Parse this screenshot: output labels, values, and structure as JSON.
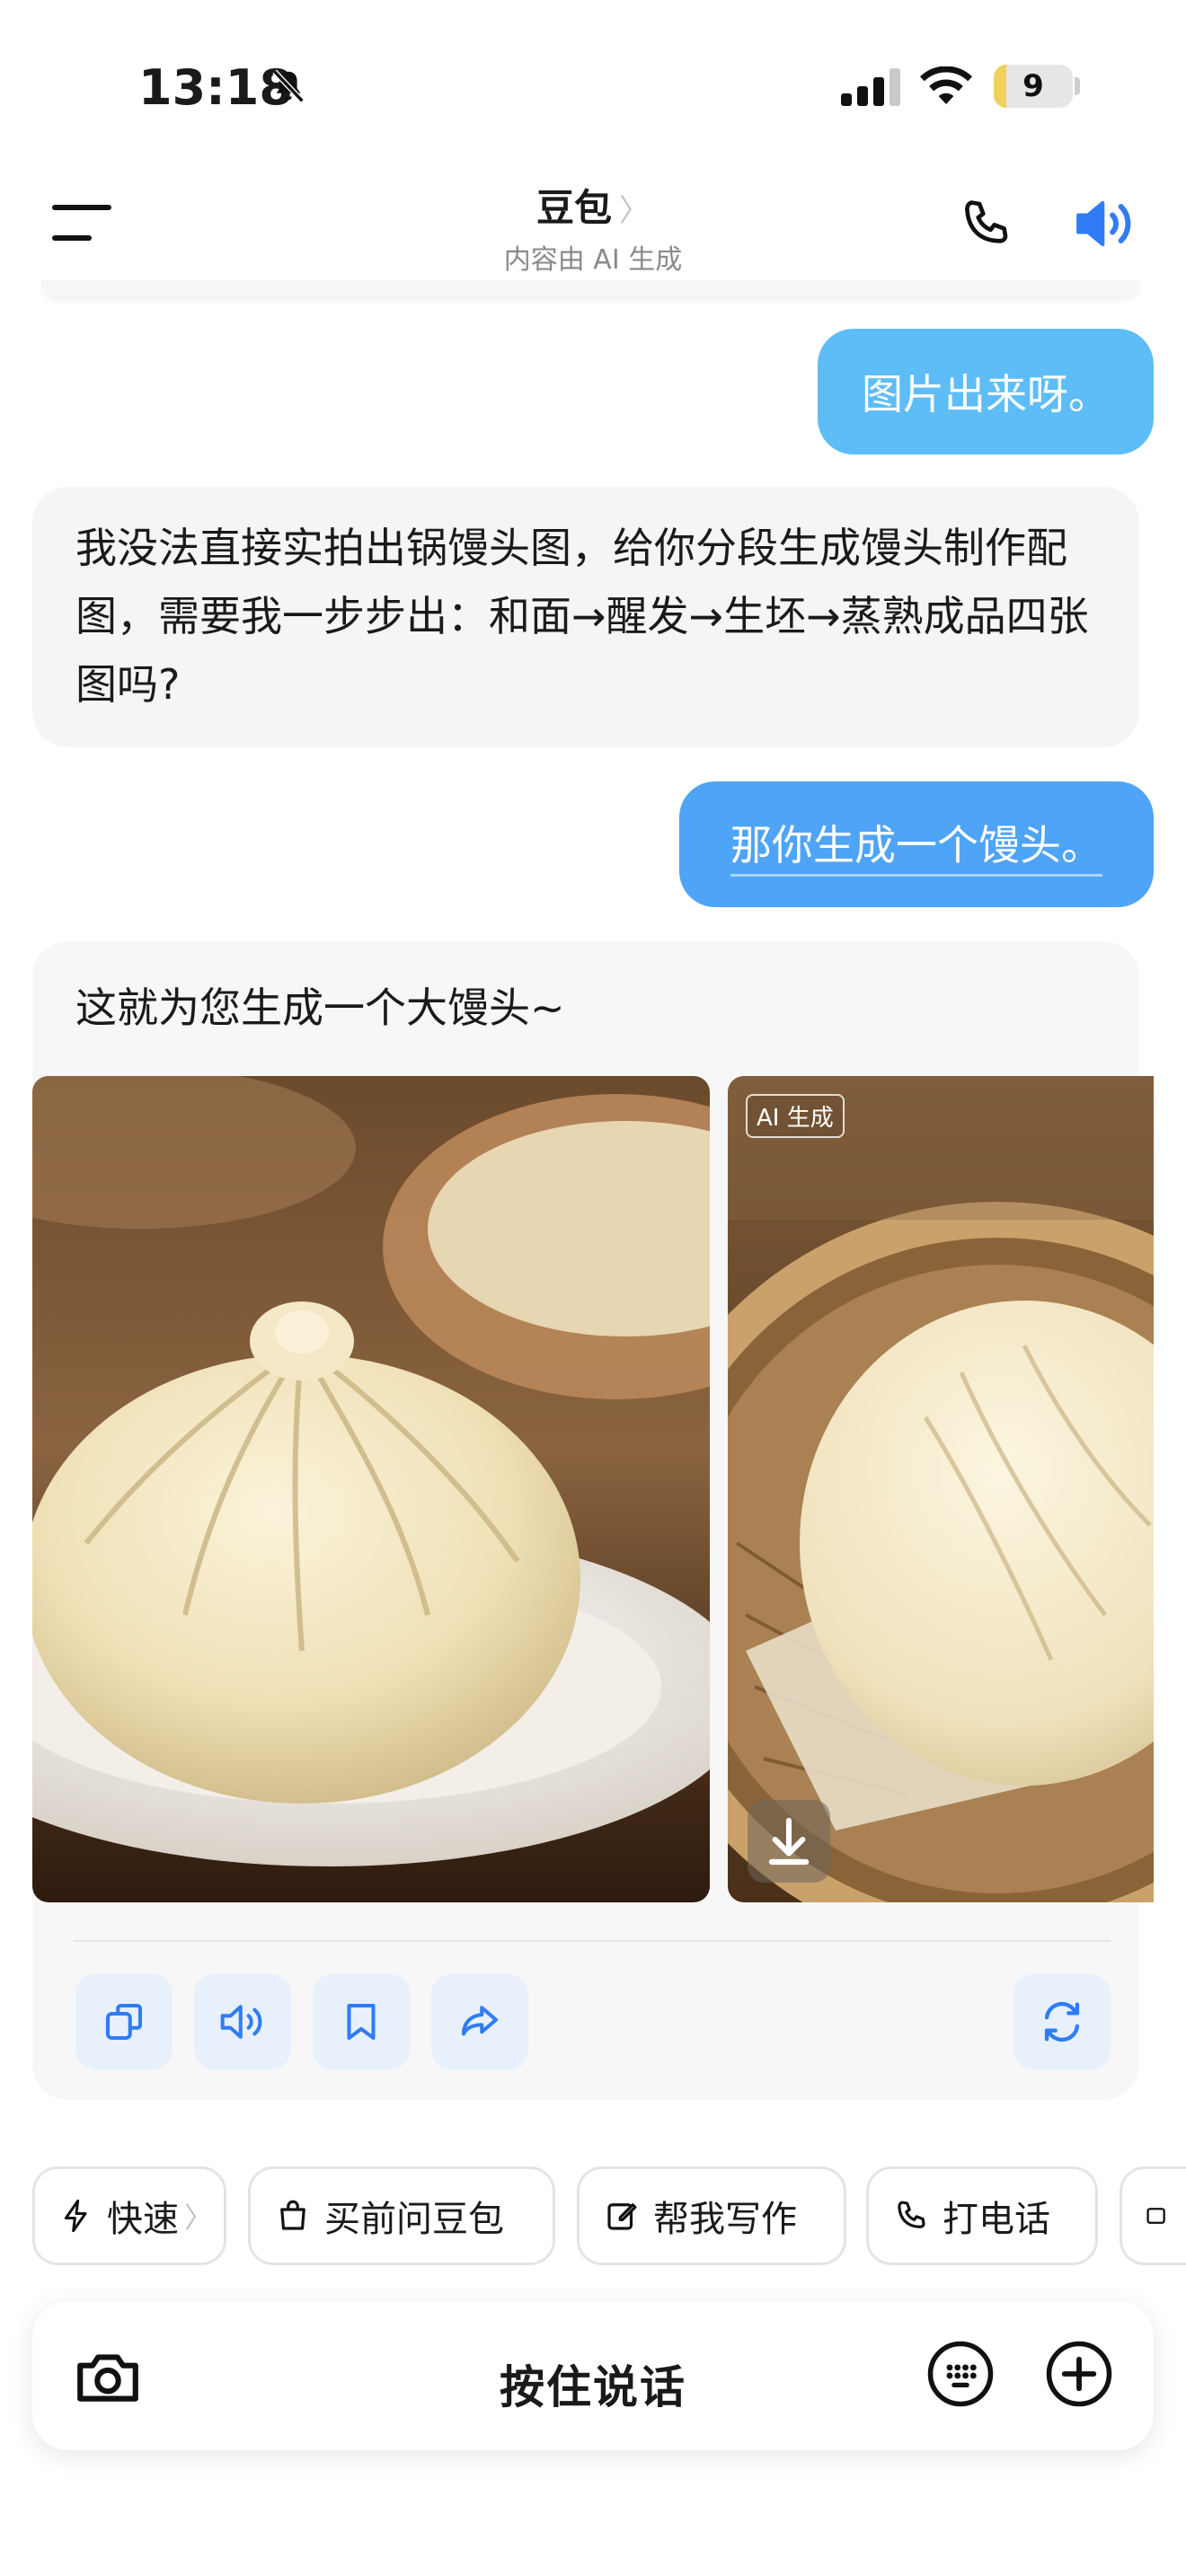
{
  "status_bar": {
    "time": "13:18",
    "battery": "9",
    "battery_level": 0.09
  },
  "header": {
    "title": "豆包",
    "title_chevron": "〉",
    "subtitle": "内容由 AI 生成"
  },
  "messages": [
    {
      "role": "user",
      "text": "图片出来呀。"
    },
    {
      "role": "assistant",
      "text": "我没法直接实拍出锅馒头图，给你分段生成馒头制作配图，需要我一步步出：和面→醒发→生坯→蒸熟成品四张图吗?"
    },
    {
      "role": "user",
      "text": "那你生成一个馒头。"
    },
    {
      "role": "assistant",
      "text": "这就为您生成一个大馒头~",
      "image_tag": "AI 生成"
    }
  ],
  "message_actions": [
    "copy-icon",
    "speaker-icon",
    "bookmark-icon",
    "share-icon",
    "regenerate-icon"
  ],
  "chips": [
    {
      "label": "快速",
      "icon": "lightning-icon",
      "chevron": "〉"
    },
    {
      "label": "买前问豆包",
      "icon": "shopping-bag-icon"
    },
    {
      "label": "帮我写作",
      "icon": "edit-icon"
    },
    {
      "label": "打电话",
      "icon": "phone-icon"
    }
  ],
  "input": {
    "hold_to_talk": "按住说话"
  },
  "colors": {
    "accent": "#2f7cf6",
    "user_bubble_1": "#5ebdf6",
    "user_bubble_2": "#4ea4f6"
  }
}
